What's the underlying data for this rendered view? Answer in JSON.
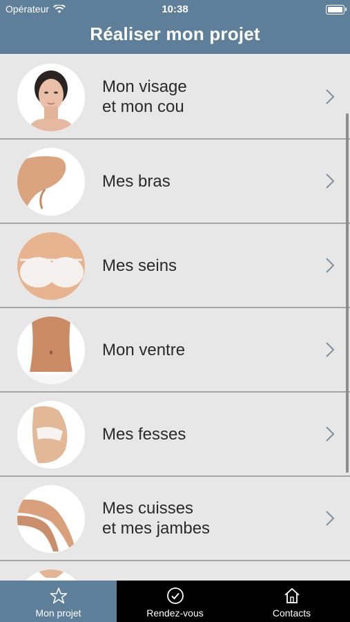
{
  "status": {
    "carrier": "Opérateur",
    "time": "10:38"
  },
  "header": {
    "title": "Réaliser mon projet"
  },
  "rows": [
    {
      "line1": "Mon visage",
      "line2": "et mon cou",
      "image": "face-neck-photo"
    },
    {
      "line1": "Mes bras",
      "line2": "",
      "image": "arm-photo"
    },
    {
      "line1": "Mes seins",
      "line2": "",
      "image": "chest-photo"
    },
    {
      "line1": "Mon ventre",
      "line2": "",
      "image": "belly-photo"
    },
    {
      "line1": "Mes fesses",
      "line2": "",
      "image": "buttocks-photo"
    },
    {
      "line1": "Mes cuisses",
      "line2": "et mes jambes",
      "image": "legs-photo"
    },
    {
      "line1": "",
      "line2": "",
      "image": "partial-photo"
    }
  ],
  "tabs": [
    {
      "label": "Mon projet",
      "icon": "star-icon",
      "active": true
    },
    {
      "label": "Rendez-vous",
      "icon": "check-circle-icon",
      "active": false
    },
    {
      "label": "Contacts",
      "icon": "home-icon",
      "active": false
    }
  ],
  "colors": {
    "header": "#5d7f99",
    "row_bg": "#e7e7e7",
    "separator": "#a4a4a4",
    "tabbar": "#000000"
  }
}
